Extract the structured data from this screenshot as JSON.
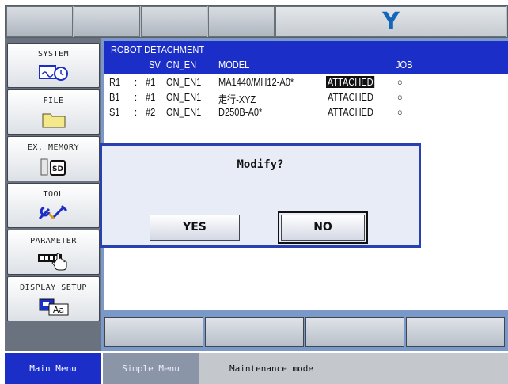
{
  "header": {
    "logo_text": "Y"
  },
  "sidebar": {
    "items": [
      {
        "label": "SYSTEM",
        "icon": "system-display-clock-icon"
      },
      {
        "label": "FILE",
        "icon": "folder-icon"
      },
      {
        "label": "EX. MEMORY",
        "icon": "sd-card-icon"
      },
      {
        "label": "TOOL",
        "icon": "tools-icon"
      },
      {
        "label": "PARAMETER",
        "icon": "parameter-hand-icon"
      },
      {
        "label": "DISPLAY SETUP",
        "icon": "display-setup-icon"
      }
    ]
  },
  "screen": {
    "title": "ROBOT DETACHMENT",
    "columns": {
      "sv": "SV",
      "on_en": "ON_EN",
      "model": "MODEL",
      "job": "JOB"
    },
    "rows": [
      {
        "group": "R1",
        "sep": ":",
        "sv": "#1",
        "on_en": "ON_EN1",
        "model": "MA1440/MH12-A0*",
        "status": "ATTACHED",
        "job": "○"
      },
      {
        "group": "B1",
        "sep": ":",
        "sv": "#1",
        "on_en": "ON_EN1",
        "model": "走行-XYZ",
        "status": "ATTACHED",
        "job": "○"
      },
      {
        "group": "S1",
        "sep": ":",
        "sv": "#2",
        "on_en": "ON_EN1",
        "model": "D250B-A0*",
        "status": "ATTACHED",
        "job": "○"
      }
    ]
  },
  "dialog": {
    "message": "Modify?",
    "yes_label": "YES",
    "no_label": "NO"
  },
  "statusbar": {
    "main_menu": "Main Menu",
    "simple_menu": "Simple Menu",
    "mode": "Maintenance mode"
  },
  "colors": {
    "accent": "#1c2ec8",
    "highlight": "#111111",
    "logo": "#1466b8"
  }
}
